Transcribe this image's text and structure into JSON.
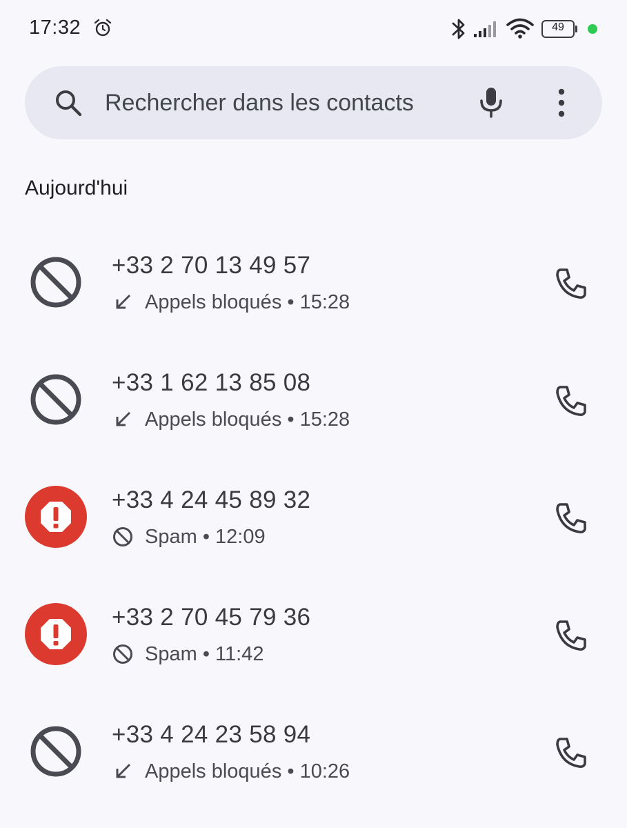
{
  "status_bar": {
    "time": "17:32",
    "battery_percent": "49",
    "icons": [
      "alarm-icon",
      "bluetooth-icon",
      "signal-icon",
      "wifi-icon",
      "battery-icon"
    ]
  },
  "search": {
    "placeholder": "Rechercher dans les contacts",
    "icons": [
      "search-icon",
      "mic-icon",
      "more-vert-icon"
    ]
  },
  "section": {
    "title": "Aujourd'hui"
  },
  "calls": [
    {
      "number": "+33 2 70 13 49 57",
      "type": "blocked",
      "detail": "Appels bloqués • 15:28",
      "avatar_icon": "block-icon",
      "sub_icon": "incoming-arrow-icon"
    },
    {
      "number": "+33 1 62 13 85 08",
      "type": "blocked",
      "detail": "Appels bloqués • 15:28",
      "avatar_icon": "block-icon",
      "sub_icon": "incoming-arrow-icon"
    },
    {
      "number": "+33 4 24 45 89 32",
      "type": "spam",
      "detail": "Spam • 12:09",
      "avatar_icon": "spam-warning-icon",
      "sub_icon": "small-block-icon"
    },
    {
      "number": "+33 2 70 45 79 36",
      "type": "spam",
      "detail": "Spam • 11:42",
      "avatar_icon": "spam-warning-icon",
      "sub_icon": "small-block-icon"
    },
    {
      "number": "+33 4 24 23 58 94",
      "type": "blocked",
      "detail": "Appels bloqués • 10:26",
      "avatar_icon": "block-icon",
      "sub_icon": "incoming-arrow-icon"
    }
  ],
  "colors": {
    "background": "#f8f8fc",
    "search_bg": "#e8e8f2",
    "spam_red": "#dc3a2e",
    "icon_gray": "#4a4a52",
    "status_green": "#2ecc55"
  }
}
